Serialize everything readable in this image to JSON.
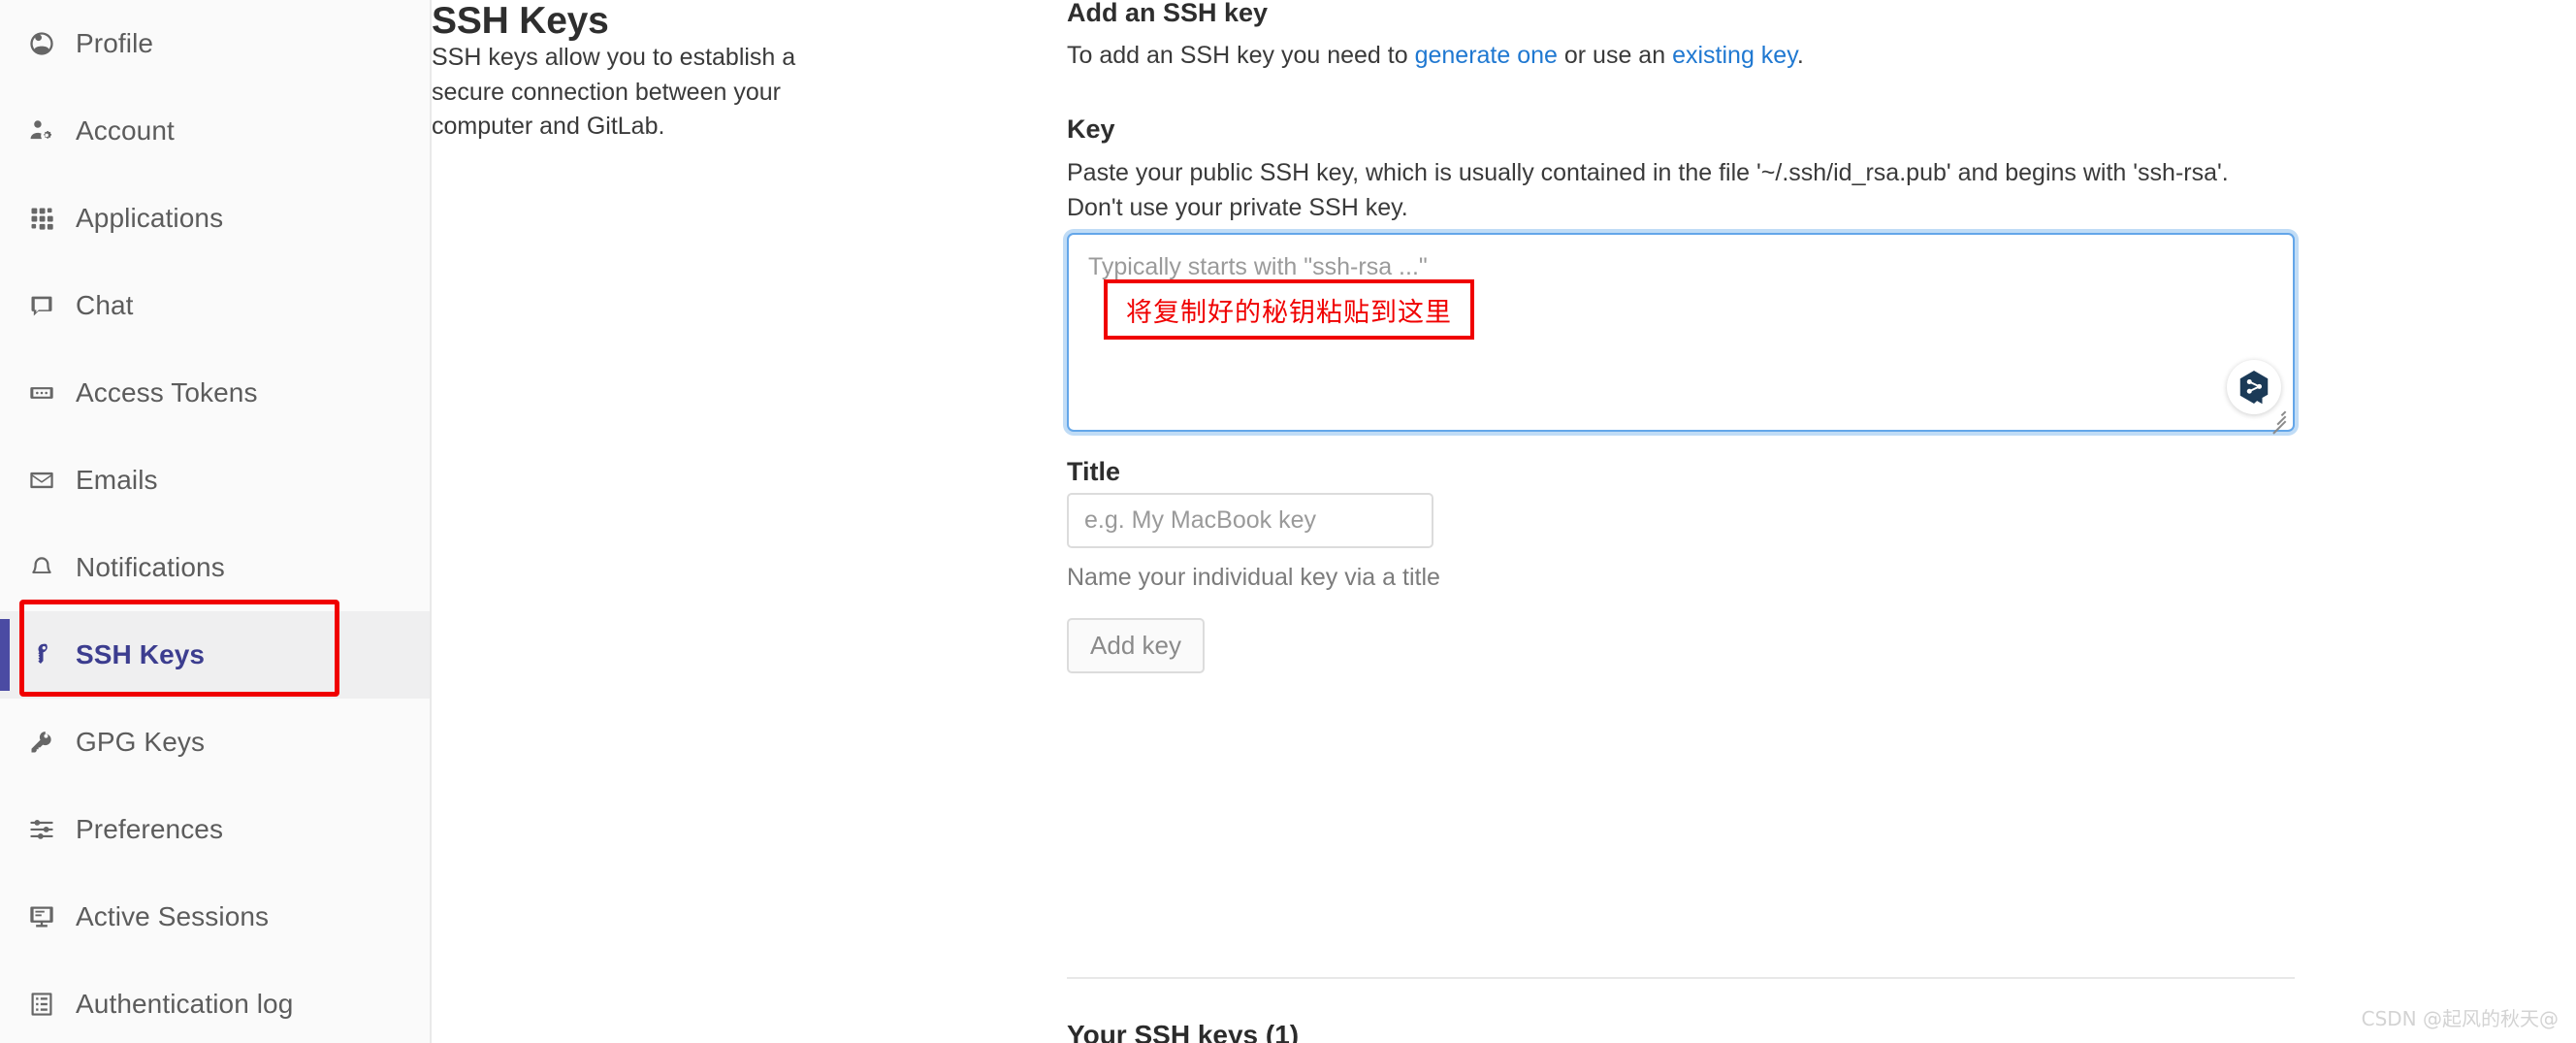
{
  "sidebar": {
    "items": [
      {
        "label": "Profile",
        "icon": "user-circle-icon",
        "active": false
      },
      {
        "label": "Account",
        "icon": "user-gear-icon",
        "active": false
      },
      {
        "label": "Applications",
        "icon": "grid-apps-icon",
        "active": false
      },
      {
        "label": "Chat",
        "icon": "chat-bubble-icon",
        "active": false
      },
      {
        "label": "Access Tokens",
        "icon": "token-icon",
        "active": false
      },
      {
        "label": "Emails",
        "icon": "envelope-icon",
        "active": false
      },
      {
        "label": "Notifications",
        "icon": "bell-icon",
        "active": false
      },
      {
        "label": "SSH Keys",
        "icon": "key-icon",
        "active": true
      },
      {
        "label": "GPG Keys",
        "icon": "key-outline-icon",
        "active": false
      },
      {
        "label": "Preferences",
        "icon": "sliders-icon",
        "active": false
      },
      {
        "label": "Active Sessions",
        "icon": "monitor-icon",
        "active": false
      },
      {
        "label": "Authentication log",
        "icon": "log-list-icon",
        "active": false
      }
    ]
  },
  "middle": {
    "heading": "SSH Keys",
    "description": "SSH keys allow you to establish a secure connection between your computer and GitLab."
  },
  "form": {
    "add_heading": "Add an SSH key",
    "add_desc_prefix": "To add an SSH key you need to ",
    "link_generate": "generate one",
    "add_desc_middle": " or use an ",
    "link_existing": "existing key",
    "add_desc_suffix": ".",
    "key_label": "Key",
    "key_desc": "Paste your public SSH key, which is usually contained in the file '~/.ssh/id_rsa.pub' and begins with 'ssh-rsa'. Don't use your private SSH key.",
    "key_placeholder": "Typically starts with \"ssh-rsa ...\"",
    "key_value": "",
    "title_label": "Title",
    "title_placeholder": "e.g. My MacBook key",
    "title_value": "",
    "title_hint": "Name your individual key via a title",
    "add_key_button": "Add key",
    "your_keys_title": "Your SSH keys (1)"
  },
  "annotations": {
    "paste_here_text": "将复制好的秘钥粘贴到这里",
    "highlight_color": "#f00000"
  },
  "watermark": {
    "text": "CSDN @起风的秋天@"
  },
  "colors": {
    "accent_indigo": "#3c3d8f",
    "link_blue": "#1f78d1",
    "focus_blue": "#63a6e9",
    "annotation_red": "#f00000",
    "badge_navy": "#1b3a57"
  }
}
